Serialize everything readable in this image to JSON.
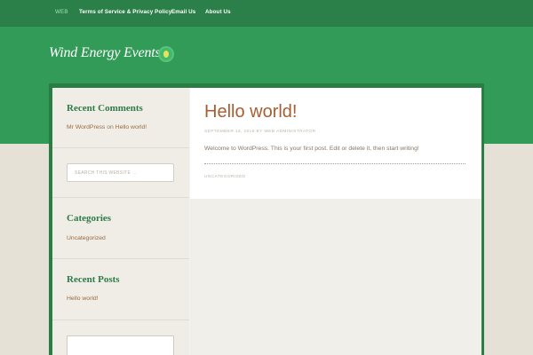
{
  "nav": {
    "items": [
      {
        "label": "WEB",
        "active": true
      },
      {
        "label": "Terms of Service & Privacy Policy",
        "active": false
      },
      {
        "label": "Email Us",
        "active": false
      },
      {
        "label": "About Us",
        "active": false
      }
    ]
  },
  "site": {
    "title": "Wind Energy Events",
    "badge_icon": "wind-badge-icon"
  },
  "sidebar": {
    "recent_comments": {
      "title": "Recent Comments",
      "author": "Mr WordPress",
      "on": "on",
      "post_link": "Hello world!"
    },
    "search": {
      "placeholder": "SEARCH THIS WEBSITE …"
    },
    "categories": {
      "title": "Categories",
      "items": [
        "Uncategorized"
      ]
    },
    "recent_posts": {
      "title": "Recent Posts",
      "items": [
        "Hello world!"
      ]
    }
  },
  "post": {
    "title": "Hello world!",
    "meta": "SEPTEMBER 16, 2015 BY WEB ADMINISTRATOR",
    "body": "Welcome to WordPress. This is your first post. Edit or delete it, then start writing!",
    "category": "UNCATEGORIZED"
  },
  "colors": {
    "header_green": "#339b58",
    "nav_green": "#2b7f48",
    "background": "#e5e1d6",
    "link_brown": "#a75e32"
  }
}
